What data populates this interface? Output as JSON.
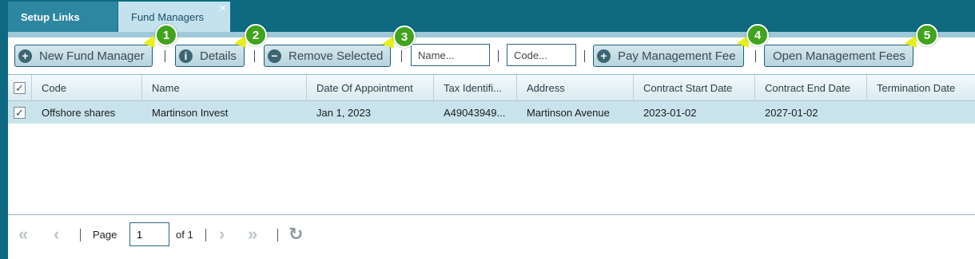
{
  "tabs": {
    "setup": "Setup Links",
    "fund": "Fund Managers",
    "close_glyph": "×"
  },
  "toolbar": {
    "new_label": "New Fund Manager",
    "details_label": "Details",
    "remove_label": "Remove Selected",
    "name_placeholder": "Name...",
    "code_placeholder": "Code...",
    "pay_label": "Pay Management Fee",
    "open_label": "Open Management Fees",
    "icons": {
      "plus": "+",
      "info": "i",
      "minus": "−"
    },
    "icon_names": [
      "plus-circle-icon",
      "info-icon",
      "minus-circle-icon"
    ]
  },
  "callouts": [
    "1",
    "2",
    "3",
    "4",
    "5"
  ],
  "grid": {
    "columns": [
      "Code",
      "Name",
      "Date Of Appointment",
      "Tax Identifi...",
      "Address",
      "Contract Start Date",
      "Contract End Date",
      "Termination Date"
    ],
    "rows": [
      {
        "checked": "✓",
        "cells": [
          "Offshore shares",
          "Martinson Invest",
          "Jan 1, 2023",
          "A49043949...",
          "Martinson Avenue",
          "2023-01-02",
          "2027-01-02",
          ""
        ]
      }
    ],
    "header_check": "✓"
  },
  "pager": {
    "first": "«",
    "prev": "‹",
    "page_label": "Page",
    "page_value": "1",
    "of_label": "of 1",
    "next": "›",
    "last": "»",
    "refresh": "↻"
  },
  "colors": {
    "brand": "#0e6a80",
    "row_selected": "#c9e3ec",
    "callout": "#3fa41c",
    "pointer": "#e8ef18"
  }
}
